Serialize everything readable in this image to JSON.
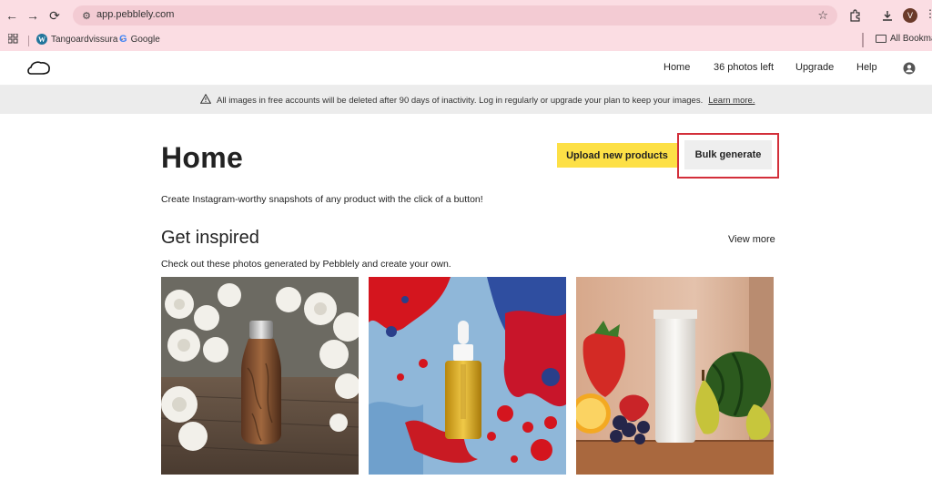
{
  "browser": {
    "url": "app.pebblely.com",
    "avatar_letter": "V",
    "bookmarks": [
      {
        "label": "Tangoardvissura -"
      },
      {
        "label": "Google"
      }
    ],
    "all_bookmarks": "All Bookmarks"
  },
  "nav": {
    "items": [
      {
        "label": "Home"
      },
      {
        "label": "36 photos left"
      },
      {
        "label": "Upgrade"
      },
      {
        "label": "Help"
      }
    ]
  },
  "banner": {
    "text": "All images in free accounts will be deleted after 90 days of inactivity. Log in regularly or upgrade your plan to keep your images.",
    "link": "Learn more."
  },
  "main": {
    "title": "Home",
    "upload_label": "Upload new products",
    "bulk_label": "Bulk generate",
    "subtitle": "Create Instagram-worthy snapshots of any product with the click of a button!",
    "inspired_title": "Get inspired",
    "view_more": "View more",
    "inspired_desc": "Check out these photos generated by Pebblely and create your own."
  },
  "colors": {
    "chrome_bg": "#fbdde3",
    "upload_button": "#fde046",
    "highlight_frame": "#d32f3a"
  }
}
